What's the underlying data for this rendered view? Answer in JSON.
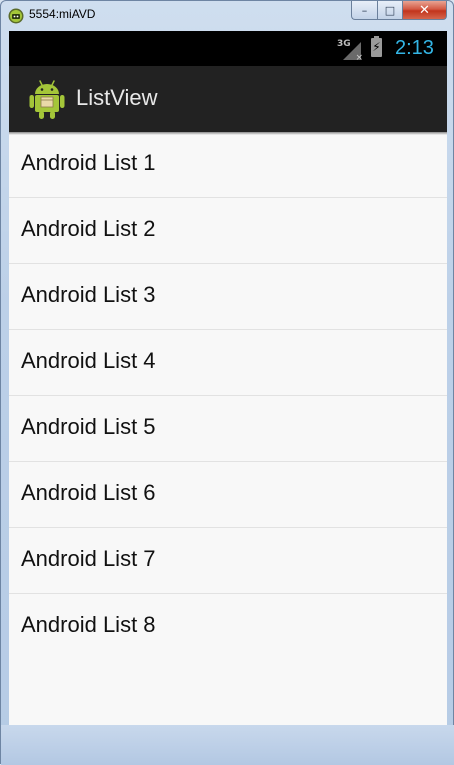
{
  "window": {
    "title": "5554:miAVD",
    "controls": {
      "minimize": "–",
      "maximize": "□",
      "close": "✕"
    }
  },
  "statusbar": {
    "network": "3G",
    "network_off_mark": "×",
    "battery_glyph": "⚡",
    "time": "2:13"
  },
  "actionbar": {
    "icon": "android-robot-icon",
    "title": "ListView"
  },
  "list": {
    "items": [
      {
        "label": "Android List 1"
      },
      {
        "label": "Android List 2"
      },
      {
        "label": "Android List 3"
      },
      {
        "label": "Android List 4"
      },
      {
        "label": "Android List 5"
      },
      {
        "label": "Android List 6"
      },
      {
        "label": "Android List 7"
      },
      {
        "label": "Android List 8"
      }
    ]
  },
  "colors": {
    "status_time": "#33b5e5",
    "actionbar_bg": "#222222",
    "list_bg": "#f8f8f8",
    "android_green": "#a4c639"
  }
}
